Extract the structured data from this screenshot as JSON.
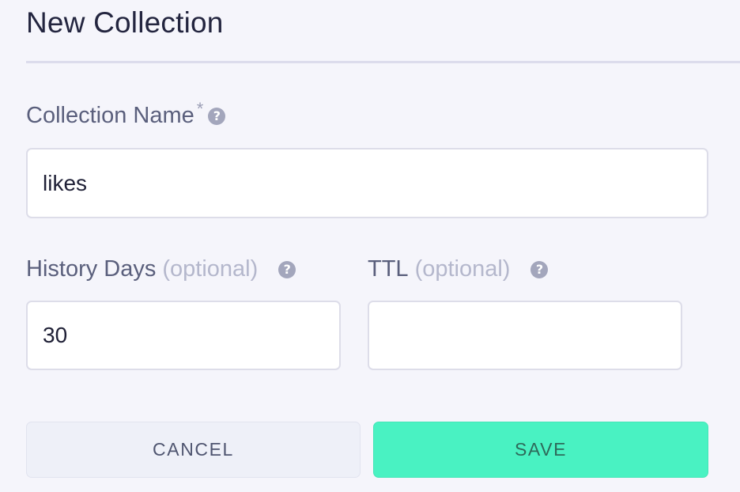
{
  "dialog": {
    "title": "New Collection"
  },
  "form": {
    "collection_name": {
      "label": "Collection Name",
      "required_marker": "*",
      "help_icon": "question-circle-icon",
      "value": "likes"
    },
    "history_days": {
      "label": "History Days",
      "optional_text": "(optional)",
      "help_icon": "question-circle-icon",
      "value": "30"
    },
    "ttl": {
      "label": "TTL",
      "optional_text": "(optional)",
      "help_icon": "question-circle-icon",
      "value": ""
    }
  },
  "actions": {
    "cancel_label": "CANCEL",
    "save_label": "SAVE"
  },
  "colors": {
    "background": "#f5f5fb",
    "save_accent": "#49f2c2",
    "cancel_bg": "#eef0f8",
    "help_icon": "#a3a6bc"
  }
}
